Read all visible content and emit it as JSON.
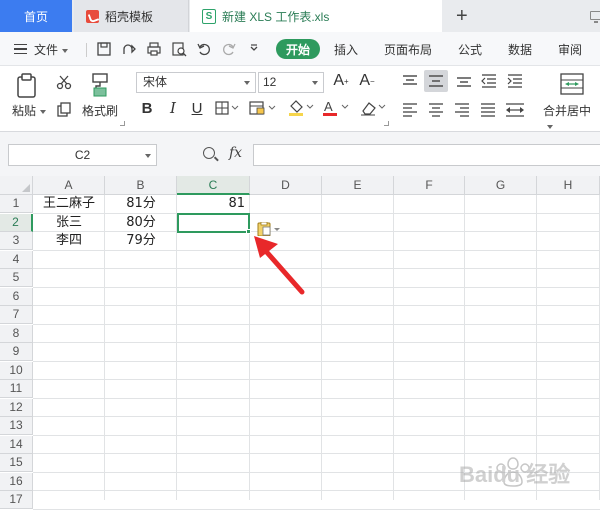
{
  "tabs": {
    "home": "首页",
    "template": "稻壳模板",
    "doc": "新建 XLS 工作表.xls",
    "add": "+"
  },
  "menu": {
    "file": "文件",
    "start": "开始",
    "items": [
      "插入",
      "页面布局",
      "公式",
      "数据",
      "审阅"
    ]
  },
  "ribbon": {
    "paste": "粘贴",
    "format_painter": "格式刷",
    "font": "宋体",
    "size": "12",
    "merge": "合并居中",
    "bold": "B",
    "italic": "I",
    "underline": "U"
  },
  "formula_bar": {
    "name_box": "C2",
    "fx": "fx",
    "value": ""
  },
  "sheet": {
    "columns": [
      "A",
      "B",
      "C",
      "D",
      "E",
      "F",
      "G",
      "H"
    ],
    "active_column": "C",
    "rows": [
      "1",
      "2",
      "3",
      "4",
      "5",
      "6",
      "7",
      "8",
      "9",
      "10",
      "11",
      "12",
      "13",
      "14",
      "15",
      "16",
      "17"
    ],
    "active_row": "2",
    "cells": {
      "A1": "王二麻子",
      "B1": "81分",
      "C1": "81",
      "A2": "张三",
      "B2": "80分",
      "A3": "李四",
      "B3": "79分"
    }
  },
  "colors": {
    "accent": "#2e9a5e",
    "tab_home": "#3c7cf0",
    "arrow": "#e8282a"
  },
  "watermark": "Baidu 经验"
}
